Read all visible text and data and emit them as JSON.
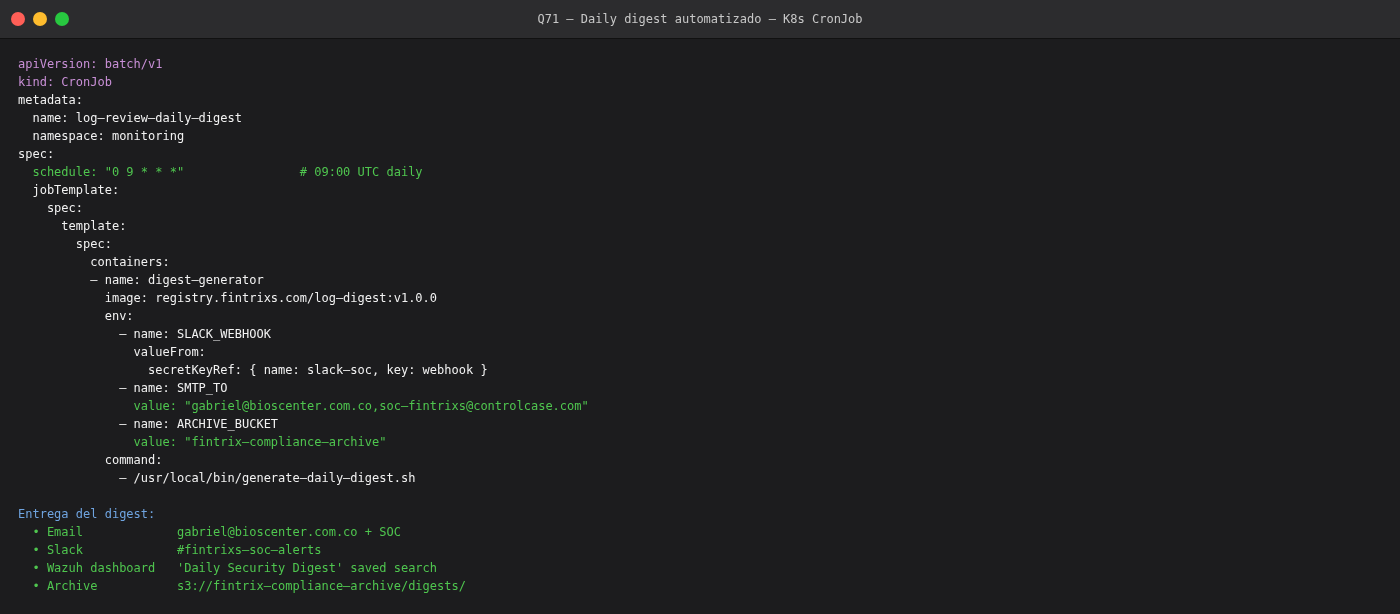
{
  "window": {
    "title": "Q71 — Daily digest automatizado — K8s CronJob"
  },
  "lines": [
    {
      "kind": "meta",
      "text": "apiVersion: batch/v1"
    },
    {
      "kind": "meta",
      "text": "kind: CronJob"
    },
    {
      "kind": "plain",
      "text": "metadata:"
    },
    {
      "kind": "plain",
      "text": "  name: log—review—daily—digest"
    },
    {
      "kind": "plain",
      "text": "  namespace: monitoring"
    },
    {
      "kind": "plain",
      "text": "spec:"
    },
    {
      "kind": "green",
      "text": "  schedule: \"0 9 * * *\"                # 09:00 UTC daily"
    },
    {
      "kind": "plain",
      "text": "  jobTemplate:"
    },
    {
      "kind": "plain",
      "text": "    spec:"
    },
    {
      "kind": "plain",
      "text": "      template:"
    },
    {
      "kind": "plain",
      "text": "        spec:"
    },
    {
      "kind": "plain",
      "text": "          containers:"
    },
    {
      "kind": "plain",
      "text": "          — name: digest—generator"
    },
    {
      "kind": "plain",
      "text": "            image: registry.fintrixs.com/log—digest:v1.0.0"
    },
    {
      "kind": "plain",
      "text": "            env:"
    },
    {
      "kind": "plain",
      "text": "              — name: SLACK_WEBHOOK"
    },
    {
      "kind": "plain",
      "text": "                valueFrom:"
    },
    {
      "kind": "plain",
      "text": "                  secretKeyRef: { name: slack—soc, key: webhook }"
    },
    {
      "kind": "plain",
      "text": "              — name: SMTP_TO"
    },
    {
      "kind": "green",
      "text": "                value: \"gabriel@bioscenter.com.co,soc—fintrixs@controlcase.com\""
    },
    {
      "kind": "plain",
      "text": "              — name: ARCHIVE_BUCKET"
    },
    {
      "kind": "green",
      "text": "                value: \"fintrix—compliance—archive\""
    },
    {
      "kind": "plain",
      "text": "            command:"
    },
    {
      "kind": "plain",
      "text": "              — /usr/local/bin/generate—daily—digest.sh"
    },
    {
      "kind": "blank"
    },
    {
      "kind": "heading",
      "text": "Entrega del digest:"
    },
    {
      "kind": "green",
      "text": "  • Email             gabriel@bioscenter.com.co + SOC"
    },
    {
      "kind": "green",
      "text": "  • Slack             #fintrixs—soc—alerts"
    },
    {
      "kind": "green",
      "text": "  • Wazuh dashboard   'Daily Security Digest' saved search"
    },
    {
      "kind": "green",
      "text": "  • Archive           s3://fintrix—compliance—archive/digests/"
    }
  ]
}
